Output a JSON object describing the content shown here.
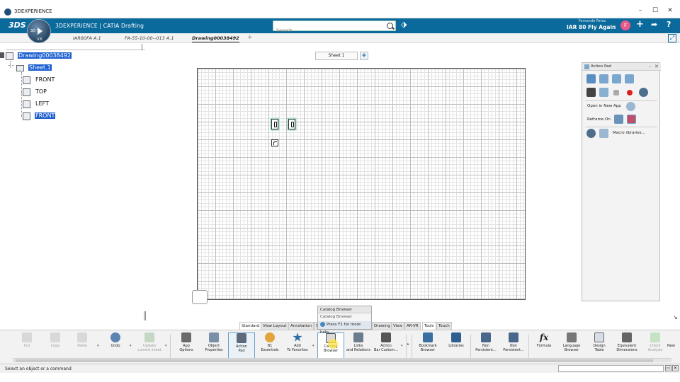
{
  "window": {
    "title": "3DEXPERIENCE"
  },
  "header": {
    "brand": "3DEXPERIENCE | CATIA Drafting",
    "compass_version": "V.6",
    "compass_3d": "3D",
    "search_placeholder": "Search",
    "user_name": "Fernando Perez",
    "user_role": "IAR 80 Fly Again ⌄",
    "avatar_initial": "F"
  },
  "tabs": [
    {
      "label": "IAR80FA A.1"
    },
    {
      "label": "FA-55-10-00--013 A.1"
    },
    {
      "label": "Drawing00038492"
    }
  ],
  "tree": {
    "root": "Drawing00038492",
    "sheet": "Sheet.1",
    "views": [
      "FRONT",
      "TOP",
      "LEFT",
      "FRONT"
    ]
  },
  "canvas": {
    "sheet_tab": "Sheet 1",
    "add_sheet": "+"
  },
  "action_pad": {
    "title": "Action Pad",
    "open_in_new_app": "Open in New App",
    "reframe_on": "Reframe On",
    "macro_libraries": "Macro libraries..."
  },
  "section_tabs": [
    "Standard",
    "View Layout",
    "Annotation",
    "S",
    "Drawing",
    "View",
    "AR-VR",
    "Tools",
    "Touch"
  ],
  "tooltip": {
    "title": "Catalog Browser",
    "desc": "Catalog Browser",
    "help": "Press F1 for more help."
  },
  "ribbon": {
    "cut": "Cut",
    "copy": "Copy",
    "paste": "Paste",
    "undo": "Undo",
    "update_1": "Update",
    "update_2": "current sheet",
    "app_options_1": "App",
    "app_options_2": "Options",
    "object_properties_1": "Object",
    "object_properties_2": "Properties",
    "action_pad_1": "Action",
    "action_pad_2": "Pad",
    "b1_essentials_1": "B1",
    "b1_essentials_2": "Essentials",
    "add_favorites_1": "Add",
    "add_favorites_2": "To Favorites",
    "catalog_browser_1": "Catalog",
    "catalog_browser_2": "Browser",
    "links_relations_1": "Links",
    "links_relations_2": "and Relations",
    "action_bar_1": "Action",
    "action_bar_2": "Bar Custom...",
    "bookmark_browser_1": "Bookmark",
    "bookmark_browser_2": "Browser",
    "libraries": "Libraries",
    "non_persistent_a_1": "Non",
    "non_persistent_a_2": "Persistent...",
    "non_persistent_b_1": "Non",
    "non_persistent_b_2": "Persistent...",
    "formula": "Formula",
    "language_browser_1": "Language",
    "language_browser_2": "Browser",
    "design_table_1": "Design",
    "design_table_2": "Table",
    "equivalent_dimensions_1": "Equivalent",
    "equivalent_dimensions_2": "Dimensions",
    "check_analysis_1": "Check",
    "check_analysis_2": "Analysis",
    "new_more": "New"
  },
  "status": {
    "message": "Select an object or a command"
  },
  "colors": {
    "accent": "#0b6a9c",
    "selection": "#1c5fd0"
  },
  "icons": {
    "search": "search-icon",
    "tag": "tag-icon",
    "add": "plus-icon",
    "share": "share-icon",
    "help": "help-icon"
  }
}
